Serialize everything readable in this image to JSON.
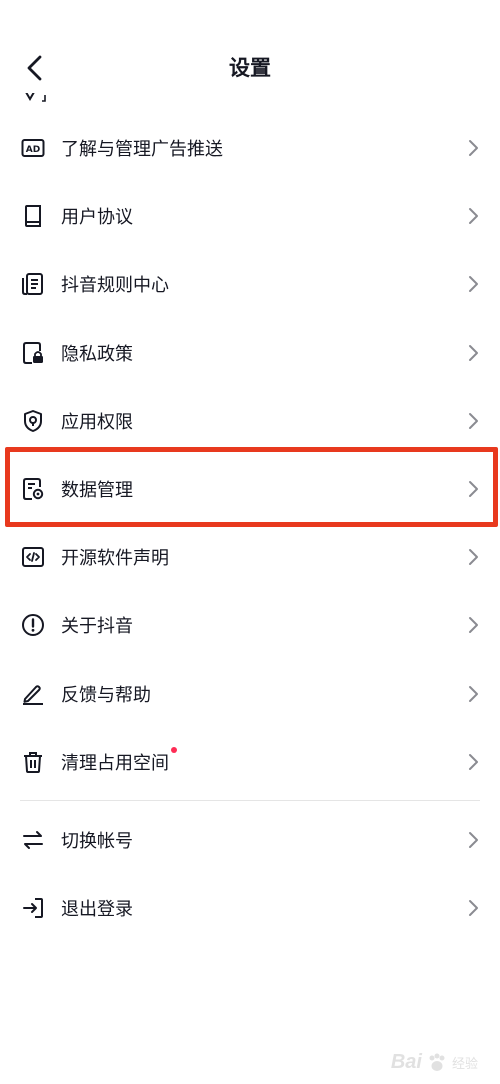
{
  "header": {
    "title": "设置"
  },
  "menu": [
    {
      "label": "了解与管理广告推送",
      "icon": "ad-icon"
    },
    {
      "label": "用户协议",
      "icon": "book-icon"
    },
    {
      "label": "抖音规则中心",
      "icon": "document-list-icon"
    },
    {
      "label": "隐私政策",
      "icon": "document-lock-icon"
    },
    {
      "label": "应用权限",
      "icon": "shield-icon"
    },
    {
      "label": "数据管理",
      "icon": "document-gear-icon"
    },
    {
      "label": "开源软件声明",
      "icon": "code-icon"
    },
    {
      "label": "关于抖音",
      "icon": "info-icon"
    },
    {
      "label": "反馈与帮助",
      "icon": "pen-icon"
    },
    {
      "label": "清理占用空间",
      "icon": "trash-icon",
      "badge_color": "#fe2c55"
    }
  ],
  "account": [
    {
      "label": "切换帐号",
      "icon": "swap-icon"
    },
    {
      "label": "退出登录",
      "icon": "logout-icon"
    }
  ],
  "highlight_color": "#e8391e",
  "watermark": {
    "text": "Bai",
    "sub": "经验"
  }
}
